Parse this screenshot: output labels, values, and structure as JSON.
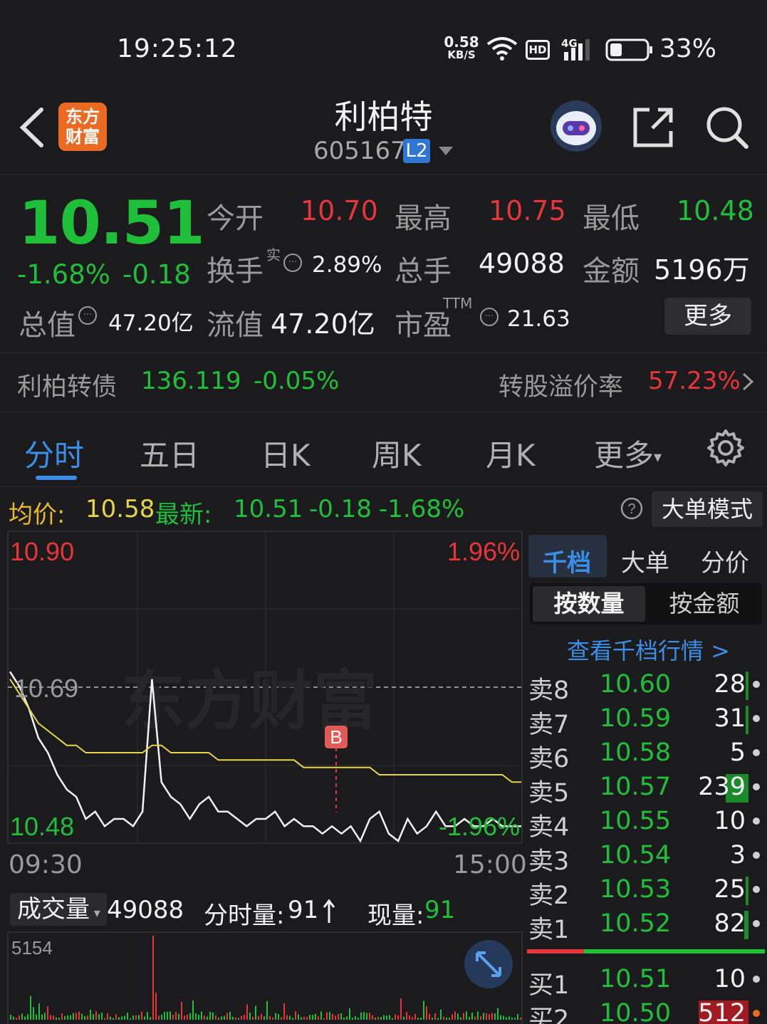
{
  "status_bar": {
    "time": "19:25:12",
    "net_speed_value": "0.58",
    "net_speed_unit": "KB/S",
    "hd": "HD",
    "network": "4G",
    "battery": "33%"
  },
  "header": {
    "logo_line1": "东方",
    "logo_line2": "财富",
    "stock_name": "利柏特",
    "stock_code": "605167",
    "level": "L2"
  },
  "quote": {
    "price": "10.51",
    "change_pct": "-1.68%",
    "change": "-0.18",
    "open_label": "今开",
    "open": "10.70",
    "high_label": "最高",
    "high": "10.75",
    "low_label": "最低",
    "low": "10.48",
    "turnover_label": "换手",
    "turnover_sup": "实",
    "turnover": "2.89%",
    "volume_label": "总手",
    "volume": "49088",
    "amount_label": "金额",
    "amount": "5196万",
    "mcap_label": "总值",
    "mcap": "47.20亿",
    "float_label": "流值",
    "float": "47.20亿",
    "pe_label": "市盈",
    "pe_sup": "TTM",
    "pe": "21.63",
    "more": "更多"
  },
  "bond": {
    "name": "利柏转债",
    "price": "136.119",
    "change": "-0.05%",
    "premium_label": "转股溢价率",
    "premium": "57.23%"
  },
  "tabs": [
    "分时",
    "五日",
    "日K",
    "周K",
    "月K",
    "更多"
  ],
  "avg_row": {
    "avg_label": "均价:",
    "avg": "10.58",
    "last_label": "最新:",
    "last": "10.51",
    "chg": "-0.18",
    "pct": "-1.68%",
    "big_order_mode": "大单模式"
  },
  "chart": {
    "y_top": "10.90",
    "y_mid": "10.69",
    "y_bottom": "10.48",
    "pct_top": "1.96%",
    "pct_bottom": "-1.96%",
    "t_start": "09:30",
    "t_end": "15:00",
    "marker": "B",
    "watermark": "东方财富"
  },
  "chart_data": {
    "type": "line",
    "ylim": [
      10.48,
      10.9
    ],
    "series": [
      {
        "values": [
          10.71,
          10.69,
          10.66,
          10.62,
          10.6,
          10.57,
          10.55,
          10.54,
          10.51,
          10.52,
          10.5,
          10.51,
          10.51,
          10.5,
          10.52,
          10.7,
          10.56,
          10.54,
          10.53,
          10.51,
          10.53,
          10.54,
          10.52,
          10.52,
          10.51,
          10.5,
          10.51,
          10.51,
          10.52,
          10.5,
          10.51,
          10.5,
          10.5,
          10.49,
          10.5,
          10.49,
          10.5,
          10.48,
          10.51,
          10.52,
          10.49,
          10.48,
          10.51,
          10.49,
          10.5,
          10.52,
          10.5,
          10.5,
          10.51,
          10.5,
          10.5,
          10.51,
          10.5,
          10.5,
          10.5
        ]
      },
      {
        "values": [
          10.7,
          10.68,
          10.66,
          10.64,
          10.63,
          10.62,
          10.61,
          10.61,
          10.6,
          10.6,
          10.6,
          10.6,
          10.6,
          10.6,
          10.6,
          10.61,
          10.61,
          10.6,
          10.6,
          10.6,
          10.6,
          10.6,
          10.59,
          10.59,
          10.59,
          10.59,
          10.59,
          10.59,
          10.59,
          10.59,
          10.59,
          10.58,
          10.58,
          10.58,
          10.58,
          10.58,
          10.58,
          10.58,
          10.58,
          10.57,
          10.57,
          10.57,
          10.57,
          10.57,
          10.57,
          10.57,
          10.57,
          10.57,
          10.57,
          10.57,
          10.57,
          10.57,
          10.57,
          10.56,
          10.56
        ]
      }
    ]
  },
  "volume_row": {
    "label": "成交量",
    "total": "49088",
    "minute_label": "分时量:",
    "minute": "91",
    "current_label": "现量:",
    "current": "91",
    "max": "5154"
  },
  "panel": {
    "tabs": [
      "千档",
      "大单",
      "分价"
    ],
    "toggle": [
      "按数量",
      "按金额"
    ],
    "view_link": "查看千档行情 >",
    "asks": [
      {
        "label": "卖8",
        "price": "10.60",
        "vol": "28"
      },
      {
        "label": "卖7",
        "price": "10.59",
        "vol": "31"
      },
      {
        "label": "卖6",
        "price": "10.58",
        "vol": "5"
      },
      {
        "label": "卖5",
        "price": "10.57",
        "vol": "239"
      },
      {
        "label": "卖4",
        "price": "10.55",
        "vol": "10"
      },
      {
        "label": "卖3",
        "price": "10.54",
        "vol": "3"
      },
      {
        "label": "卖2",
        "price": "10.53",
        "vol": "25"
      },
      {
        "label": "卖1",
        "price": "10.52",
        "vol": "82"
      }
    ],
    "bids": [
      {
        "label": "买1",
        "price": "10.51",
        "vol": "10"
      },
      {
        "label": "买2",
        "price": "10.50",
        "vol": "512"
      }
    ]
  }
}
